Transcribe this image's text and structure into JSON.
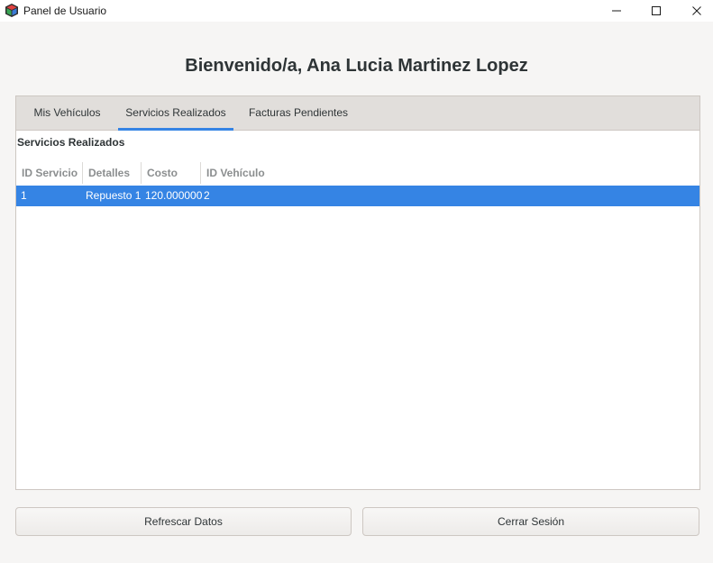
{
  "window": {
    "title": "Panel de Usuario",
    "controls": [
      "minimize-icon",
      "maximize-icon",
      "close-icon"
    ]
  },
  "welcome": "Bienvenido/a, Ana Lucia Martinez Lopez",
  "tabs": [
    {
      "label": "Mis Vehículos",
      "active": false
    },
    {
      "label": "Servicios Realizados",
      "active": true
    },
    {
      "label": "Facturas Pendientes",
      "active": false
    }
  ],
  "panel": {
    "section_title": "Servicios Realizados",
    "columns": [
      "ID Servicio",
      "Detalles",
      "Costo",
      "ID Vehículo"
    ],
    "rows": [
      {
        "id_servicio": "1",
        "detalles": "Repuesto 1",
        "costo": "120.000000",
        "id_vehiculo": "2",
        "selected": true
      }
    ]
  },
  "buttons": {
    "refresh": "Refrescar Datos",
    "logout": "Cerrar Sesión"
  },
  "colors": {
    "accent": "#3584e4",
    "background": "#f6f5f4",
    "tabbar": "#e1dedb"
  }
}
